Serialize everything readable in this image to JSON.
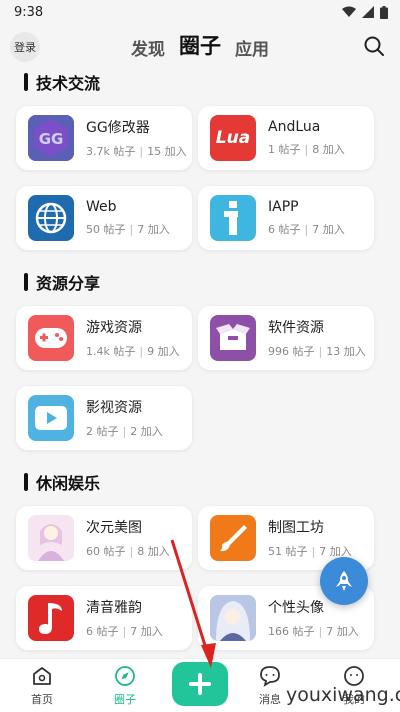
{
  "status": {
    "time": "9:38"
  },
  "header": {
    "login_label": "登录",
    "tabs": [
      {
        "label": "发现",
        "active": false
      },
      {
        "label": "圈子",
        "active": true
      },
      {
        "label": "应用",
        "active": false
      }
    ]
  },
  "sections": [
    {
      "title": "技术交流",
      "cards": [
        {
          "name": "GG修改器",
          "posts": "3.7k 帖子",
          "joined": "15 加入"
        },
        {
          "name": "AndLua",
          "posts": "1 帖子",
          "joined": "8 加入"
        },
        {
          "name": "Web",
          "posts": "50 帖子",
          "joined": "7 加入"
        },
        {
          "name": "IAPP",
          "posts": "6 帖子",
          "joined": "7 加入"
        }
      ]
    },
    {
      "title": "资源分享",
      "cards": [
        {
          "name": "游戏资源",
          "posts": "1.4k 帖子",
          "joined": "9 加入"
        },
        {
          "name": "软件资源",
          "posts": "996 帖子",
          "joined": "13 加入"
        },
        {
          "name": "影视资源",
          "posts": "2 帖子",
          "joined": "2 加入"
        }
      ]
    },
    {
      "title": "休闲娱乐",
      "cards": [
        {
          "name": "次元美图",
          "posts": "60 帖子",
          "joined": "8 加入"
        },
        {
          "name": "制图工坊",
          "posts": "51 帖子",
          "joined": "7 加入"
        },
        {
          "name": "清音雅韵",
          "posts": "6 帖子",
          "joined": "7 加入"
        },
        {
          "name": "个性头像",
          "posts": "166 帖子",
          "joined": "7 加入"
        }
      ]
    }
  ],
  "icons": {
    "andlua_text": "Lua",
    "andlua_color": "#e53935",
    "web_color": "#1f6bb0",
    "iapp_color": "#3fb6e0",
    "game_color": "#f05a5a",
    "software_color": "#8e4fa8",
    "video_color": "#4fb2e0",
    "drawing_color": "#f07a1a",
    "music_color": "#e02a2a",
    "accent": "#22c49a"
  },
  "nav": [
    {
      "label": "首页",
      "icon": "home-icon"
    },
    {
      "label": "圈子",
      "icon": "compass-icon"
    },
    {
      "label": "消息",
      "icon": "message-icon"
    },
    {
      "label": "我的",
      "icon": "profile-icon"
    }
  ],
  "watermark": "youxiwang.cn"
}
